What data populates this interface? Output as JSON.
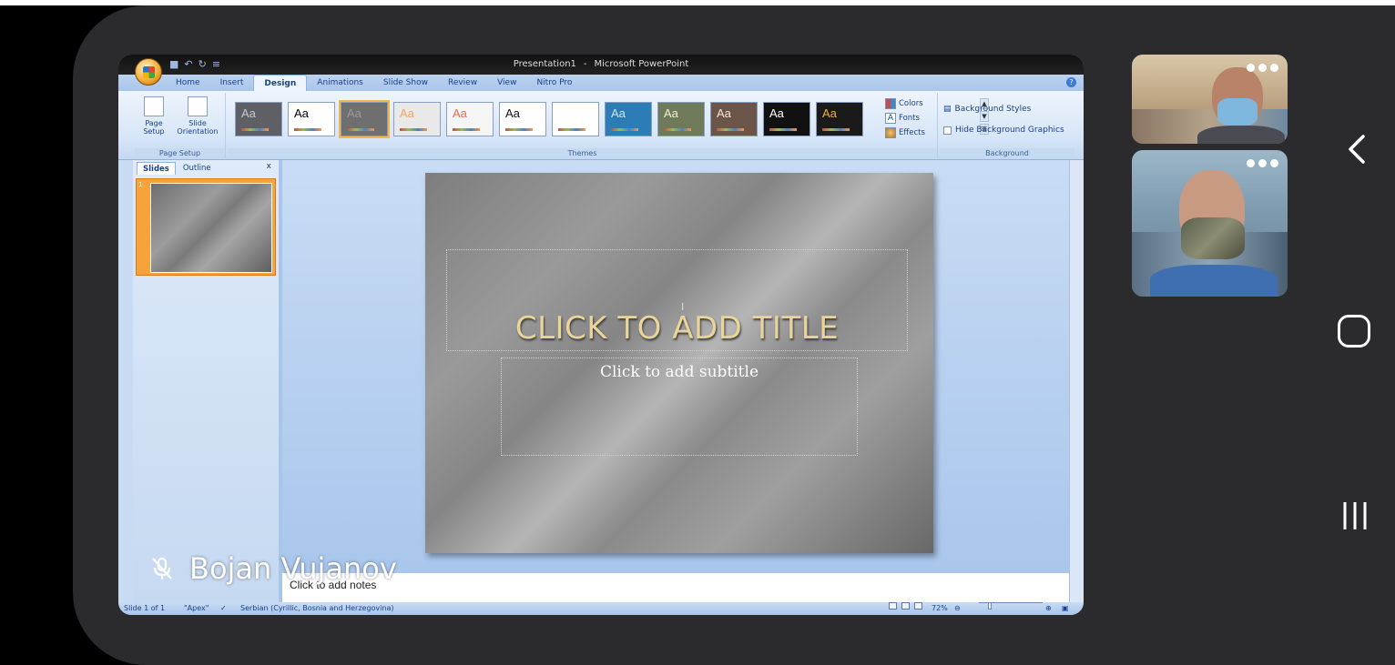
{
  "ppt": {
    "window_title_doc": "Presentation1",
    "window_title_sep": "-",
    "window_title_app": "Microsoft PowerPoint",
    "tabs": [
      "Home",
      "Insert",
      "Design",
      "Animations",
      "Slide Show",
      "Review",
      "View",
      "Nitro Pro"
    ],
    "active_tab": "Design",
    "page_setup": {
      "page_setup_label": "Page Setup",
      "slide_orientation_label": "Slide Orientation",
      "group_label": "Page Setup"
    },
    "themes": {
      "group_label": "Themes",
      "items": [
        {
          "label": "Aa",
          "bg": "#5f5f66",
          "fg": "#c9c9c9"
        },
        {
          "label": "Aa",
          "bg": "#ffffff",
          "fg": "#000000"
        },
        {
          "label": "Aa",
          "bg": "#6f6f6f",
          "fg": "#9a9a9a"
        },
        {
          "label": "Aa",
          "bg": "#e9e9e9",
          "fg": "#f4a460"
        },
        {
          "label": "Aa",
          "bg": "#f5f5f5",
          "fg": "#e07050"
        },
        {
          "label": "Aa",
          "bg": "#ffffff",
          "fg": "#111111"
        },
        {
          "label": "Aa",
          "bg": "#ffffff",
          "fg": "#ffffff"
        },
        {
          "label": "Aa",
          "bg": "#2c7cb5",
          "fg": "#cfe6f7"
        },
        {
          "label": "Aa",
          "bg": "#6e7a5a",
          "fg": "#f0f0d0"
        },
        {
          "label": "Aa",
          "bg": "#6b5548",
          "fg": "#f5e6d6"
        },
        {
          "label": "Aa",
          "bg": "#111111",
          "fg": "#ffffff"
        },
        {
          "label": "Aa",
          "bg": "#1a1a1a",
          "fg": "#f1b23a"
        }
      ]
    },
    "theme_options": {
      "colors": "Colors",
      "fonts": "Fonts",
      "effects": "Effects"
    },
    "background": {
      "styles": "Background Styles",
      "hide_graphics": "Hide Background Graphics",
      "group_label": "Background"
    },
    "pane": {
      "tab_slides": "Slides",
      "tab_outline": "Outline",
      "close": "x",
      "thumb_number": "1"
    },
    "slide": {
      "title_placeholder": "CLICK TO ADD TITLE",
      "subtitle_placeholder": "Click to add subtitle"
    },
    "notes_placeholder": "Click to add notes",
    "status": {
      "slide_info": "Slide 1 of 1",
      "theme_name": "\"Apex\"",
      "language": "Serbian (Cyrillic, Bosnia and Herzegovina)",
      "zoom": "72%"
    }
  },
  "call": {
    "presenter_name": "Bojan Vujanov",
    "mic_state": "muted"
  },
  "colors": {
    "frame": "#2b2b2d",
    "ribbon_text": "#15428b",
    "title_gold": "#e9d59a"
  }
}
